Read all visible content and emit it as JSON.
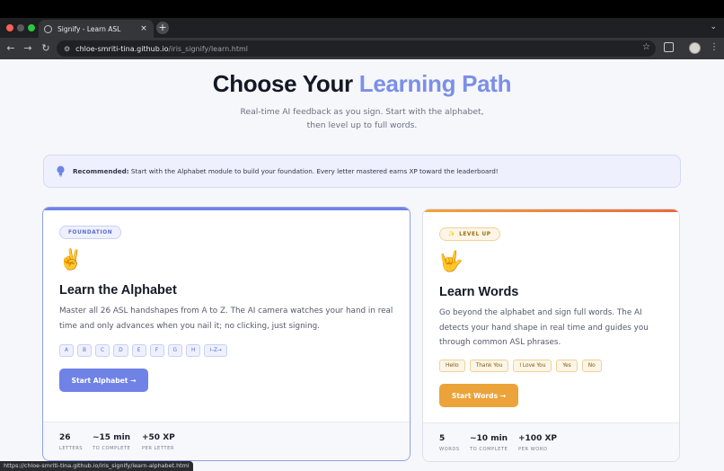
{
  "browser": {
    "tab_title": "Signify - Learn ASL",
    "tab_close": "×",
    "new_tab": "+",
    "url_host": "chloe-smriti-tina.github.io",
    "url_path": "/iris_signify/learn.html",
    "status_url": "https://chloe-smriti-tina.github.io/iris_signify/learn-alphabet.html",
    "icons": {
      "back": "back-arrow-icon",
      "forward": "forward-arrow-icon",
      "reload": "reload-icon",
      "site_info": "site-info-icon",
      "bookmark": "star-icon",
      "extensions": "extensions-icon",
      "menu": "kebab-menu-icon"
    }
  },
  "hero": {
    "title_plain": "Choose Your ",
    "title_accent": "Learning Path",
    "subtitle_line1": "Real-time AI feedback as you sign. Start with the alphabet,",
    "subtitle_line2": "then level up to full words."
  },
  "banner": {
    "icon": "lightbulb-icon",
    "label": "Recommended:",
    "text": "Start with the Alphabet module to build your foundation. Every letter mastered earns XP toward the leaderboard!"
  },
  "alphabet_card": {
    "badge": "FOUNDATION",
    "emoji": "✌️",
    "title": "Learn the Alphabet",
    "description": "Master all 26 ASL handshapes from A to Z. The AI camera watches your hand in real time and only advances when you nail it; no clicking, just signing.",
    "letters": [
      "A",
      "B",
      "C",
      "D",
      "E",
      "F",
      "G",
      "H",
      "I–Z→"
    ],
    "cta": "Start Alphabet  →",
    "stats": [
      {
        "value": "26",
        "label": "LETTERS"
      },
      {
        "value": "~15 min",
        "label": "TO COMPLETE"
      },
      {
        "value": "+50 XP",
        "label": "PER LETTER"
      }
    ]
  },
  "words_card": {
    "badge_icon": "✨",
    "badge": "LEVEL UP",
    "emoji": "🤟",
    "title": "Learn Words",
    "description": "Go beyond the alphabet and sign full words. The AI detects your hand shape in real time and guides you through common ASL phrases.",
    "words": [
      "Hello",
      "Thank You",
      "I Love You",
      "Yes",
      "No"
    ],
    "cta": "Start Words  →",
    "stats": [
      {
        "value": "5",
        "label": "WORDS"
      },
      {
        "value": "~10 min",
        "label": "TO COMPLETE"
      },
      {
        "value": "+100 XP",
        "label": "PER WORD"
      }
    ]
  },
  "colors": {
    "accent": "#7b8fe8",
    "primary_button": "#6f82e6",
    "words_button": "#eba33a"
  }
}
